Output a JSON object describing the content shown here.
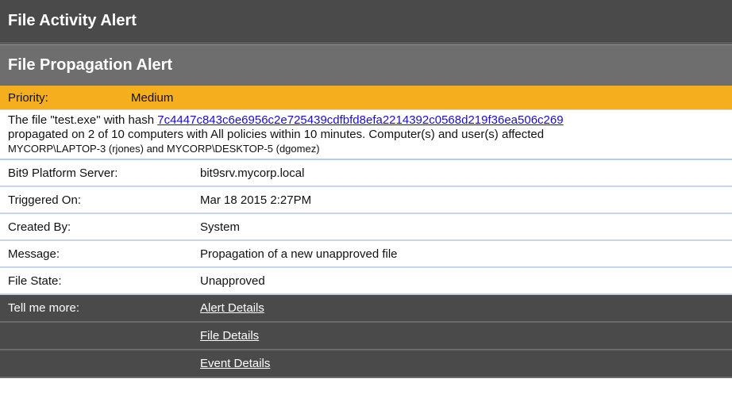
{
  "header": {
    "title": "File Activity Alert",
    "subtitle": "File Propagation Alert"
  },
  "priority": {
    "label": "Priority:",
    "value": "Medium"
  },
  "description": {
    "line1_prefix": "The file \"test.exe\" with hash ",
    "hash": "7c4447c843c6e6956c2e725439cdfbfd8efa2214392c0568d219f36ea506c269",
    "line2": "propagated on 2 of 10 computers with All policies within 10 minutes. Computer(s) and user(s) affected",
    "line3": "MYCORP\\LAPTOP-3 (rjones) and MYCORP\\DESKTOP-5 (dgomez)"
  },
  "details": [
    {
      "label": "Bit9 Platform Server:",
      "value": "bit9srv.mycorp.local"
    },
    {
      "label": "Triggered On:",
      "value": "Mar 18 2015 2:27PM"
    },
    {
      "label": "Created By:",
      "value": "System"
    },
    {
      "label": "Message:",
      "value": "Propagation of a new unapproved file"
    },
    {
      "label": "File State:",
      "value": "Unapproved"
    }
  ],
  "more": {
    "label": "Tell me more:",
    "links": [
      "Alert Details",
      "File Details",
      "Event Details"
    ]
  }
}
